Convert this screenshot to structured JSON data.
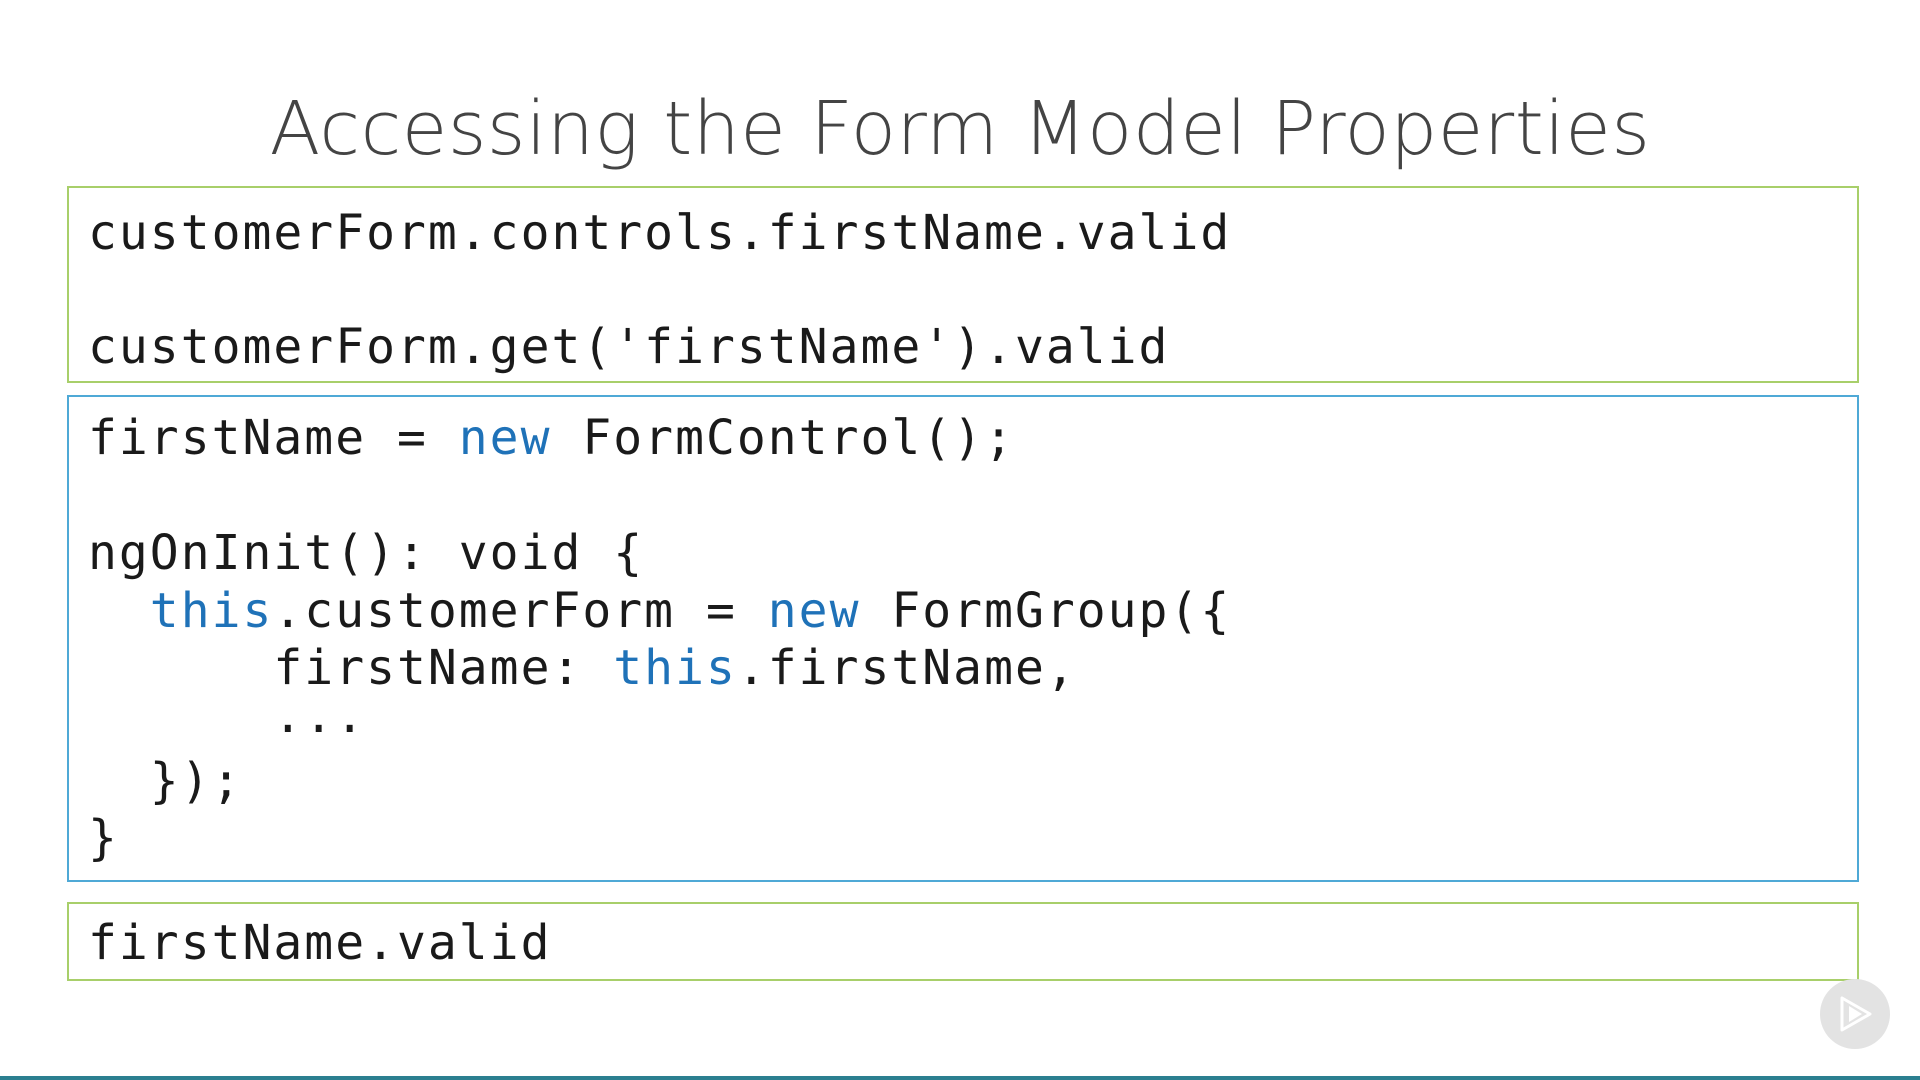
{
  "slide": {
    "title": "Accessing the Form Model Properties"
  },
  "access_box": {
    "line1": "customerForm.controls.firstName.valid",
    "line2": "customerForm.get('firstName').valid"
  },
  "control_box": {
    "line1": {
      "a": "firstName = ",
      "kw": "new",
      "b": " FormControl();"
    },
    "line2": "ngOnInit(): void {",
    "line3": {
      "indent": "  ",
      "kw1": "this",
      "a": ".customerForm = ",
      "kw2": "new",
      "b": " FormGroup({"
    },
    "line4": {
      "indent": "      ",
      "a": "firstName: ",
      "kw": "this",
      "b": ".firstName,"
    },
    "line5": "      ...",
    "line6": "  });",
    "line7": "}"
  },
  "short_box": {
    "line1": "firstName.valid"
  },
  "player": {
    "icon": "play-icon"
  },
  "colors": {
    "keyword": "#1f72b8",
    "green_border": "#a8cf6a",
    "blue_border": "#4fa9d6",
    "bottom_rule": "#2b7f90"
  }
}
